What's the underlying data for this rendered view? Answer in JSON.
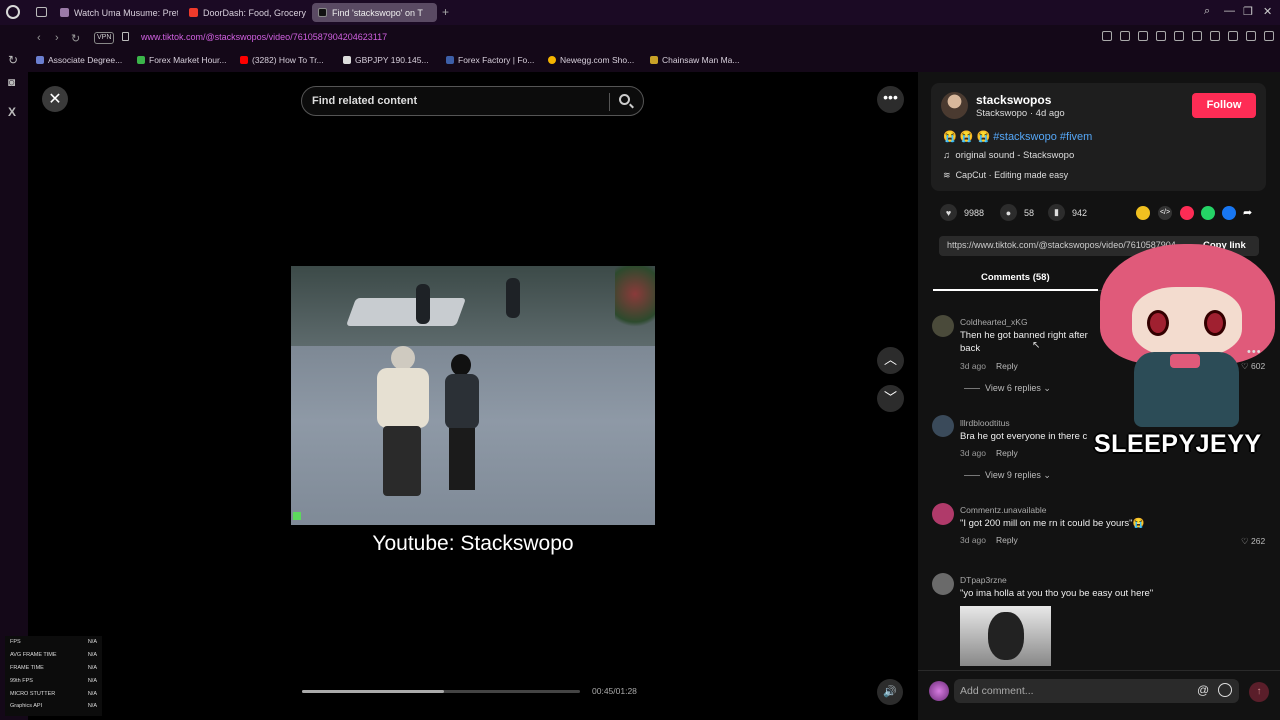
{
  "browser": {
    "tabs": [
      {
        "label": "Watch Uma Musume: Pret",
        "color": "#9b7aa8"
      },
      {
        "label": "DoorDash: Food, Grocery",
        "color": "#ef3a2b"
      },
      {
        "label": "Find 'stackswopo' on T",
        "color": "#111111"
      }
    ],
    "url_host": "www.tiktok.com",
    "url_path": "/@stackswopos/video/7610587904204623117",
    "vpn_label": "VPN",
    "bookmarks": [
      {
        "label": "Associate Degree...",
        "color": "#6b7fd0"
      },
      {
        "label": "Forex Market Hour...",
        "color": "#3bb54a"
      },
      {
        "label": "(3282) How To Tr...",
        "color": "#ff0000"
      },
      {
        "label": "GBPJPY 190.145...",
        "color": "#dddddd"
      },
      {
        "label": "Forex Factory | Fo...",
        "color": "#3d5fa8"
      },
      {
        "label": "Newegg.com Sho...",
        "color": "#f5b400"
      },
      {
        "label": "Chainsaw Man Ma...",
        "color": "#c9a227"
      }
    ]
  },
  "video": {
    "search_placeholder": "Find related content",
    "caption": "Youtube: Stackswopo",
    "time": "00:45/01:28",
    "progress": 0.51
  },
  "stats": [
    {
      "label": "FPS",
      "value": "N/A"
    },
    {
      "label": "AVG FRAME TIME",
      "value": "N/A"
    },
    {
      "label": "FRAME TIME",
      "value": "N/A"
    },
    {
      "label": "99th FPS",
      "value": "N/A"
    },
    {
      "label": "MICRO STUTTER",
      "value": "N/A"
    },
    {
      "label": "Graphics API",
      "value": "N/A"
    }
  ],
  "post": {
    "author": "stackswopos",
    "author_sub": "Stackswopo · 4d ago",
    "follow_label": "Follow",
    "desc_emoji": "😭 😭 😭",
    "desc_hashtags": "#stackswopo #fivem",
    "sound": "original sound - Stackswopo",
    "capcut": "CapCut · Editing made easy",
    "likes": "9988",
    "comments": "58",
    "saves": "942",
    "link": "https://www.tiktok.com/@stackswopos/video/7610587904204623117",
    "copy_link_label": "Copy link",
    "comments_tab": "Comments (58)"
  },
  "comments": [
    {
      "user": "Coldhearted_xKG",
      "text": "Then he got banned right after",
      "text2": "back",
      "time": "3d ago",
      "reply": "Reply",
      "likes": "602",
      "replies": "View 6 replies",
      "avatar_color": "#4a4a3a"
    },
    {
      "user": "lllrdbloodtitus",
      "text": "Bra he got everyone in there c",
      "time": "3d ago",
      "reply": "Reply",
      "likes": "",
      "replies": "View 9 replies",
      "avatar_color": "#3a4a5a"
    },
    {
      "user": "Commentz.unavailable",
      "text": "\"I got 200 mill on me rn it could be yours\"😭",
      "time": "3d ago",
      "reply": "Reply",
      "likes": "262",
      "replies": "",
      "avatar_color": "#b03a6a"
    },
    {
      "user": "DTpap3rzne",
      "text": "\"yo ima holla at you tho you be easy out here\"",
      "time": "",
      "reply": "",
      "likes": "",
      "replies": "",
      "avatar_color": "#6a6a6a"
    }
  ],
  "comment_input_placeholder": "Add comment...",
  "overlay_name": "SLEEPYJEYY"
}
